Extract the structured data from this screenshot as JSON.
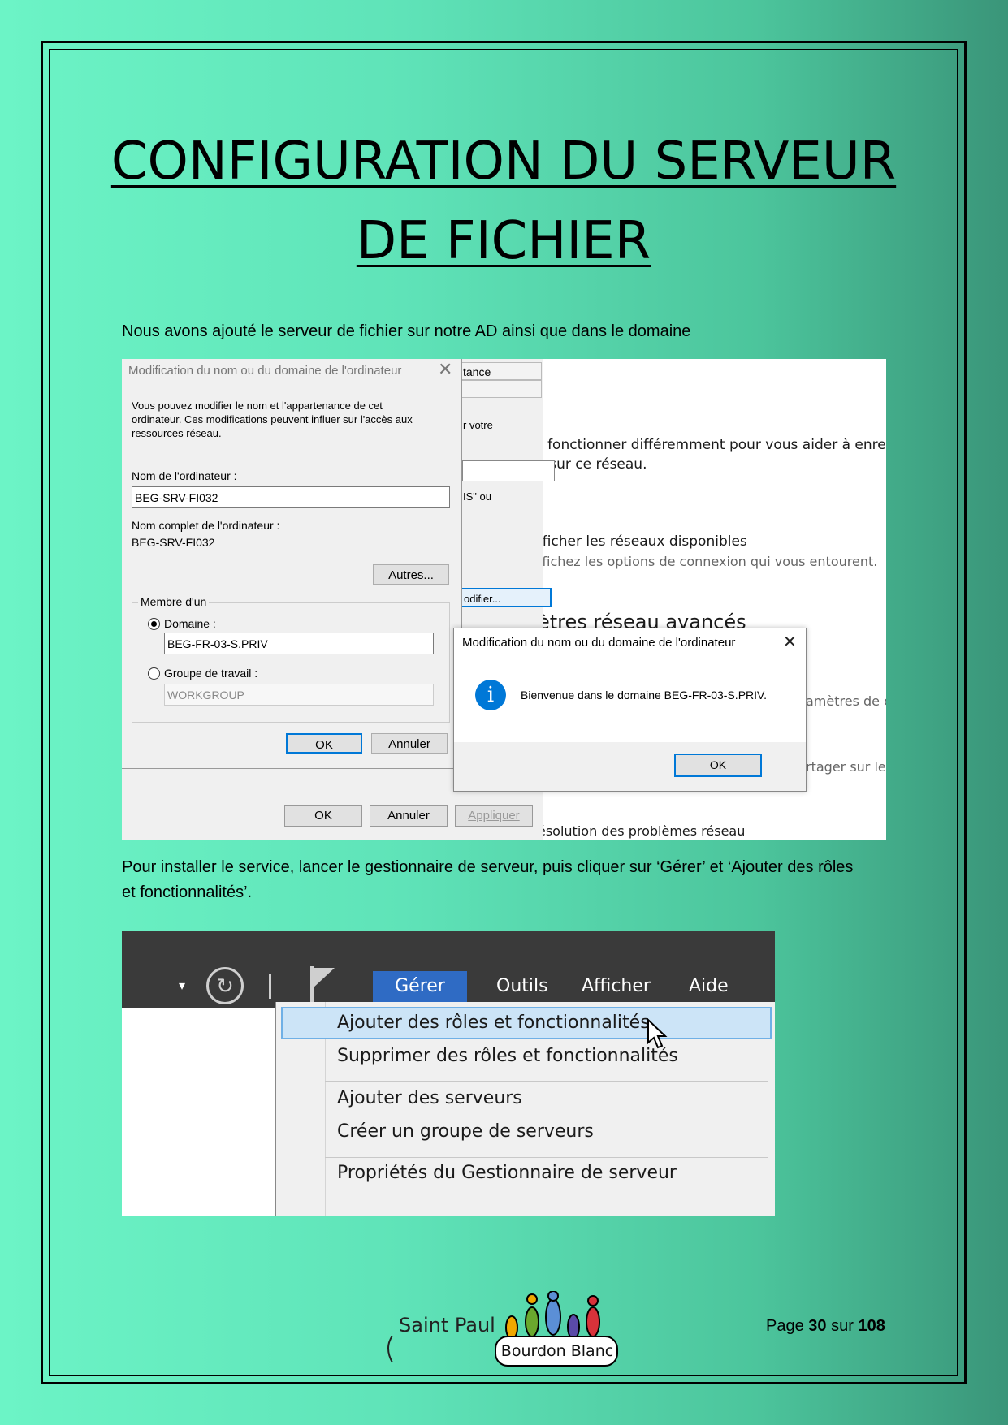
{
  "title_lines": [
    "CONFIGURATION DU SERVEUR",
    "DE FICHIER"
  ],
  "intro_text": "Nous avons ajouté le serveur de fichier sur notre AD ainsi que dans le domaine",
  "install_text": "Pour installer le service, lancer le gestionnaire de serveur, puis cliquer sur ‘Gérer’ et ‘Ajouter des rôles et fonctionnalités’.",
  "screenshot1": {
    "bg_tabs": [
      "tance"
    ],
    "bg_fragments": [
      "r votre",
      "IS\" ou",
      "odifier..."
    ],
    "bg_buttons": {
      "ok": "OK",
      "cancel": "Annuler",
      "apply": "Appliquer"
    },
    "settings_lines": [
      "t fonctionner différemment pour vous aider à enregis",
      "s sur ce réseau.",
      "fficher les réseaux disponibles",
      "ffichez les options de connexion qui vous entourent.",
      "ètres réseau avancés",
      "amètres de co",
      "rtager sur les",
      "ésolution des problèmes réseau"
    ],
    "rename_dialog": {
      "title": "Modification du nom ou du domaine de l'ordinateur",
      "description": "Vous pouvez modifier le nom et l'appartenance de cet ordinateur. Ces modifications peuvent influer sur l'accès aux ressources réseau.",
      "computer_name_label": "Nom de l'ordinateur :",
      "computer_name_value": "BEG-SRV-FI032",
      "full_name_label": "Nom complet de l'ordinateur :",
      "full_name_value": "BEG-SRV-FI032",
      "more_button": "Autres...",
      "member_of_label": "Membre d'un",
      "domain_label": "Domaine :",
      "domain_value": "BEG-FR-03-S.PRIV",
      "workgroup_label": "Groupe de travail :",
      "workgroup_value": "WORKGROUP",
      "ok_button": "OK",
      "cancel_button": "Annuler"
    },
    "welcome_dialog": {
      "title": "Modification du nom ou du domaine de l'ordinateur",
      "message": "Bienvenue dans le domaine BEG-FR-03-S.PRIV.",
      "ok_button": "OK"
    }
  },
  "screenshot2": {
    "menu_items": [
      "Gérer",
      "Outils",
      "Afficher",
      "Aide"
    ],
    "dropdown_items": [
      "Ajouter des rôles et fonctionnalités",
      "Supprimer des rôles et fonctionnalités",
      "Ajouter des serveurs",
      "Créer un groupe de serveurs",
      "Propriétés du Gestionnaire de serveur"
    ]
  },
  "footer": {
    "logo_text_top": "Saint Paul",
    "logo_text_bottom": "Bourdon Blanc",
    "page_prefix": "Page",
    "page_current": "30",
    "page_sep": "sur",
    "page_total": "108"
  },
  "colors": {
    "accent_blue": "#0078d7",
    "highlight": "#cce4f7",
    "menu_dark": "#3a3a3a"
  }
}
